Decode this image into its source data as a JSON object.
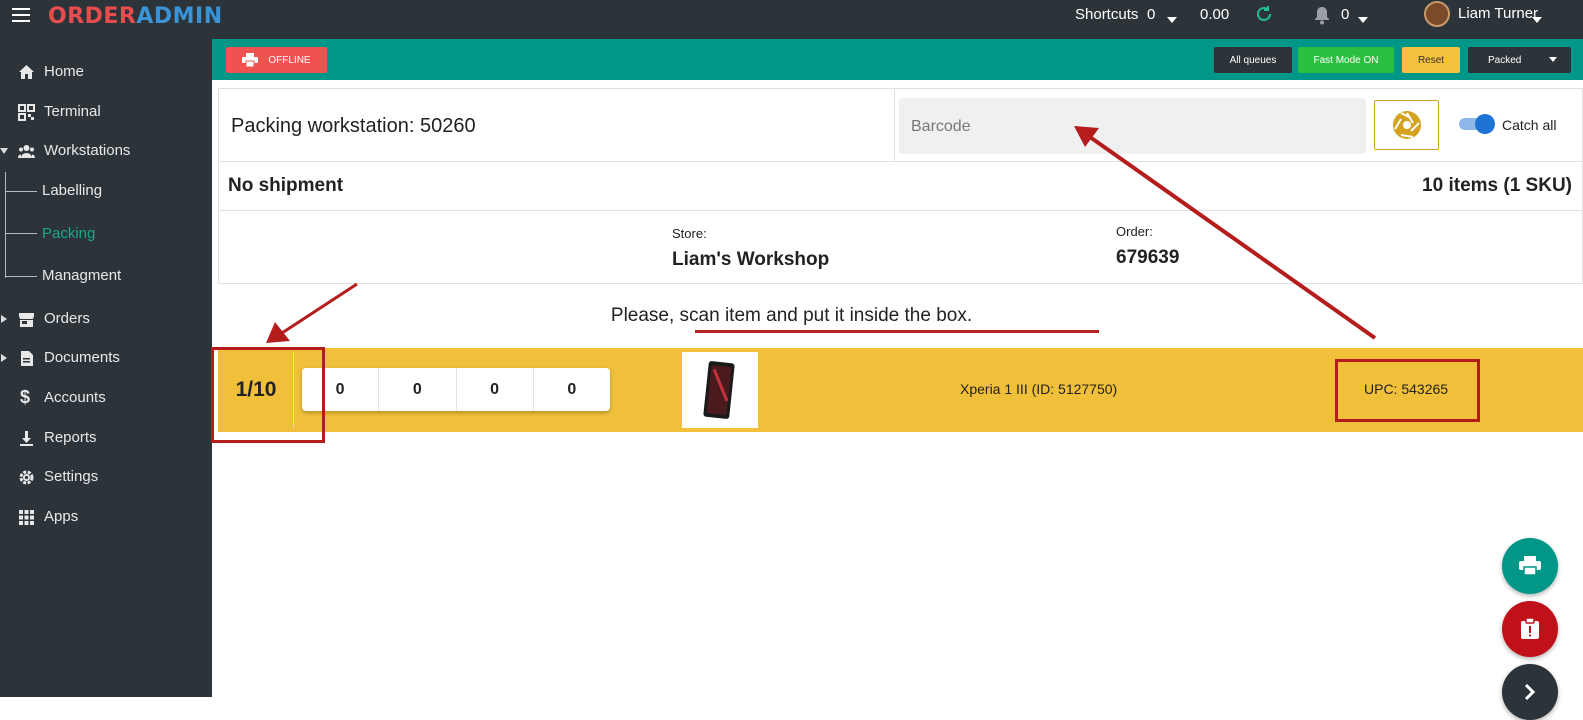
{
  "app": {
    "logo_part1": "ORDER",
    "logo_part2": "ADMIN"
  },
  "topbar": {
    "shortcuts_label": "Shortcuts",
    "shortcuts_count": "0",
    "balance": "0.00",
    "notifications_count": "0",
    "user_name": "Liam Turner"
  },
  "sidebar": {
    "items": [
      {
        "label": "Home",
        "icon": "home-icon"
      },
      {
        "label": "Terminal",
        "icon": "qr-code-icon"
      },
      {
        "label": "Workstations",
        "icon": "people-icon",
        "expanded": true
      },
      {
        "label": "Orders",
        "icon": "store-icon"
      },
      {
        "label": "Documents",
        "icon": "document-icon"
      },
      {
        "label": "Accounts",
        "icon": "dollar-icon"
      },
      {
        "label": "Reports",
        "icon": "download-icon"
      },
      {
        "label": "Settings",
        "icon": "gear-icon"
      },
      {
        "label": "Apps",
        "icon": "apps-grid-icon"
      }
    ],
    "subitems": [
      {
        "label": "Labelling"
      },
      {
        "label": "Packing",
        "active": true
      },
      {
        "label": "Managment"
      }
    ]
  },
  "toolbar": {
    "offline_label": "OFFLINE",
    "all_queues_label": "All queues",
    "fast_mode_label": "Fast Mode ON",
    "reset_label": "Reset",
    "packed_label": "Packed"
  },
  "card": {
    "workstation_label": "Packing workstation:",
    "workstation_id": "50260",
    "barcode_placeholder": "Barcode",
    "catch_all_label": "Catch all",
    "catch_all_on": true,
    "shipment_status": "No shipment",
    "items_summary": "10 items (1 SKU)",
    "store_label": "Store:",
    "store_value": "Liam's Workshop",
    "order_label": "Order:",
    "order_value": "679639"
  },
  "prompt": "Please, scan item and put it inside the box.",
  "item": {
    "progress": "1/10",
    "counters": [
      "0",
      "0",
      "0",
      "0"
    ],
    "name": "Xperia 1 III (ID: 5127750)",
    "upc": "UPC: 543265"
  },
  "colors": {
    "sidebar_bg": "#2d3439",
    "toolbar_teal": "#009688",
    "active_nav": "#1aa58c",
    "item_row": "#f0c03b",
    "annotation_red": "#b51c1c"
  }
}
